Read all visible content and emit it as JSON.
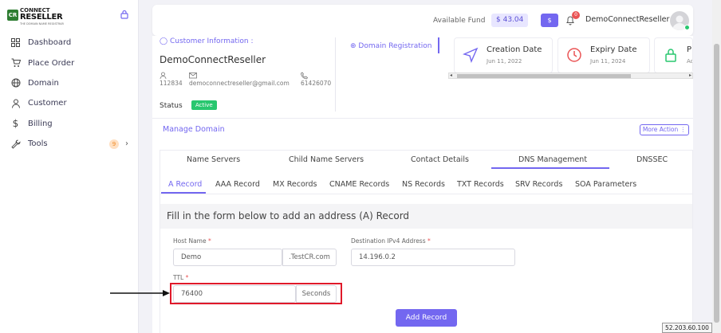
{
  "brand": {
    "line1": "CONNECT",
    "line2": "RESELLER",
    "tagline": "THE DOMAIN NAME REGISTRAR",
    "badge": "CR"
  },
  "sidebar": {
    "items": [
      {
        "label": "Dashboard",
        "icon": "grid-icon"
      },
      {
        "label": "Place Order",
        "icon": "cart-icon"
      },
      {
        "label": "Domain",
        "icon": "globe-icon"
      },
      {
        "label": "Customer",
        "icon": "user-icon"
      },
      {
        "label": "Billing",
        "icon": "dollar-icon"
      },
      {
        "label": "Tools",
        "icon": "wrench-icon",
        "badge": "9"
      }
    ]
  },
  "header": {
    "fund_label": "Available Fund",
    "fund_value": "$ 43.04",
    "dollar_button": "$",
    "notification_count": "0",
    "username": "DemoConnectReseller"
  },
  "customer": {
    "heading": "Customer Information :",
    "name": "DemoConnectReseller",
    "id": "112834",
    "email": "democonnectreseller@gmail.com",
    "phone": "61426070",
    "status_label": "Status",
    "status_value": "Active"
  },
  "domain_tab": "Domain Registration",
  "stats": [
    {
      "title": "Creation Date",
      "date": "Jun 11, 2022",
      "color": "#7367f0"
    },
    {
      "title": "Expiry Date",
      "date": "Jun 11, 2024",
      "color": "#ea5455"
    },
    {
      "title": "P",
      "date": "Ac",
      "color": "#28c76f"
    }
  ],
  "manage": {
    "title": "Manage Domain",
    "more_action": "More Action ⋮"
  },
  "tabs": [
    "Name Servers",
    "Child Name Servers",
    "Contact Details",
    "DNS Management",
    "DNSSEC"
  ],
  "active_tab": "DNS Management",
  "subtabs": [
    "A Record",
    "AAA Record",
    "MX Records",
    "CNAME Records",
    "NS Records",
    "TXT Records",
    "SRV Records",
    "SOA Parameters"
  ],
  "active_subtab": "A Record",
  "form": {
    "title": "Fill in the form below to add an address (A) Record",
    "host_label": "Host Name",
    "host_value": "Demo",
    "host_suffix": ".TestCR.com",
    "dest_label": "Destination IPv4 Address",
    "dest_value": "14.196.0.2",
    "ttl_label": "TTL",
    "ttl_value": "76400",
    "ttl_suffix": "Seconds",
    "required_mark": "*",
    "submit": "Add Record"
  },
  "ip_tooltip": "52.203.60.100",
  "colors": {
    "accent": "#7367f0",
    "success": "#28c76f",
    "danger": "#ea5455",
    "highlight": "#e0192a"
  }
}
